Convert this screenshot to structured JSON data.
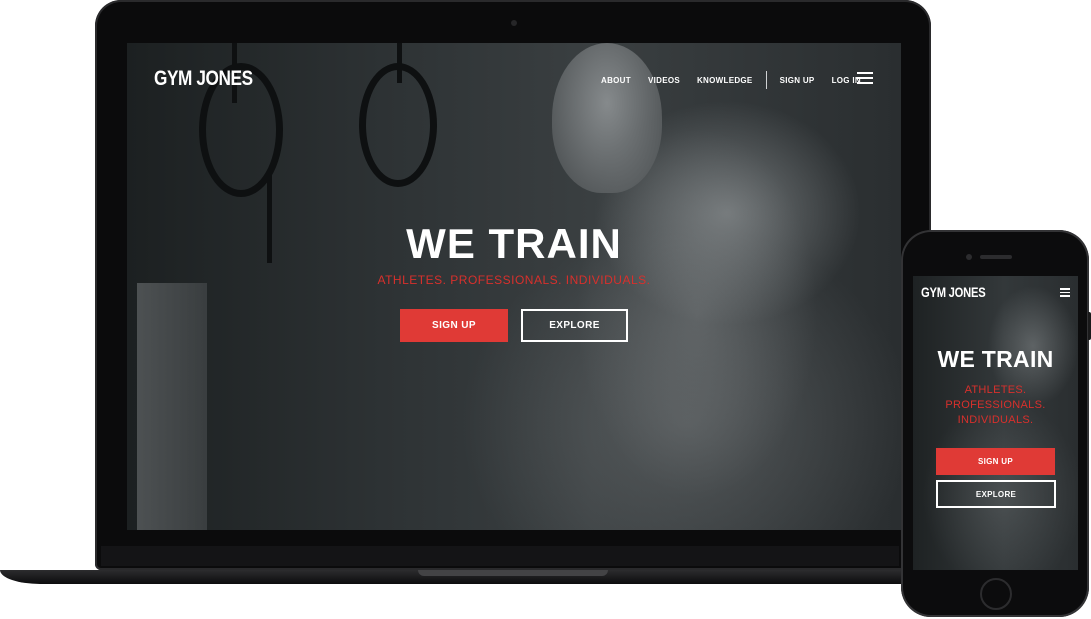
{
  "brand": {
    "logo_text": "GYM JONES",
    "accent_color": "#e03a36",
    "subtitle_color": "#d8302c"
  },
  "desktop": {
    "nav": {
      "items": [
        "ABOUT",
        "VIDEOS",
        "KNOWLEDGE",
        "SIGN UP",
        "LOG IN"
      ],
      "menu_icon": "hamburger-icon"
    },
    "hero": {
      "title": "WE TRAIN",
      "subtitle": "ATHLETES. PROFESSIONALS. INDIVIDUALS.",
      "signup_label": "SIGN UP",
      "explore_label": "EXPLORE"
    }
  },
  "mobile": {
    "nav": {
      "menu_icon": "hamburger-icon"
    },
    "hero": {
      "title": "WE TRAIN",
      "subtitle_lines": [
        "ATHLETES.",
        "PROFESSIONALS.",
        "INDIVIDUALS."
      ],
      "signup_label": "SIGN UP",
      "explore_label": "EXPLORE"
    }
  }
}
